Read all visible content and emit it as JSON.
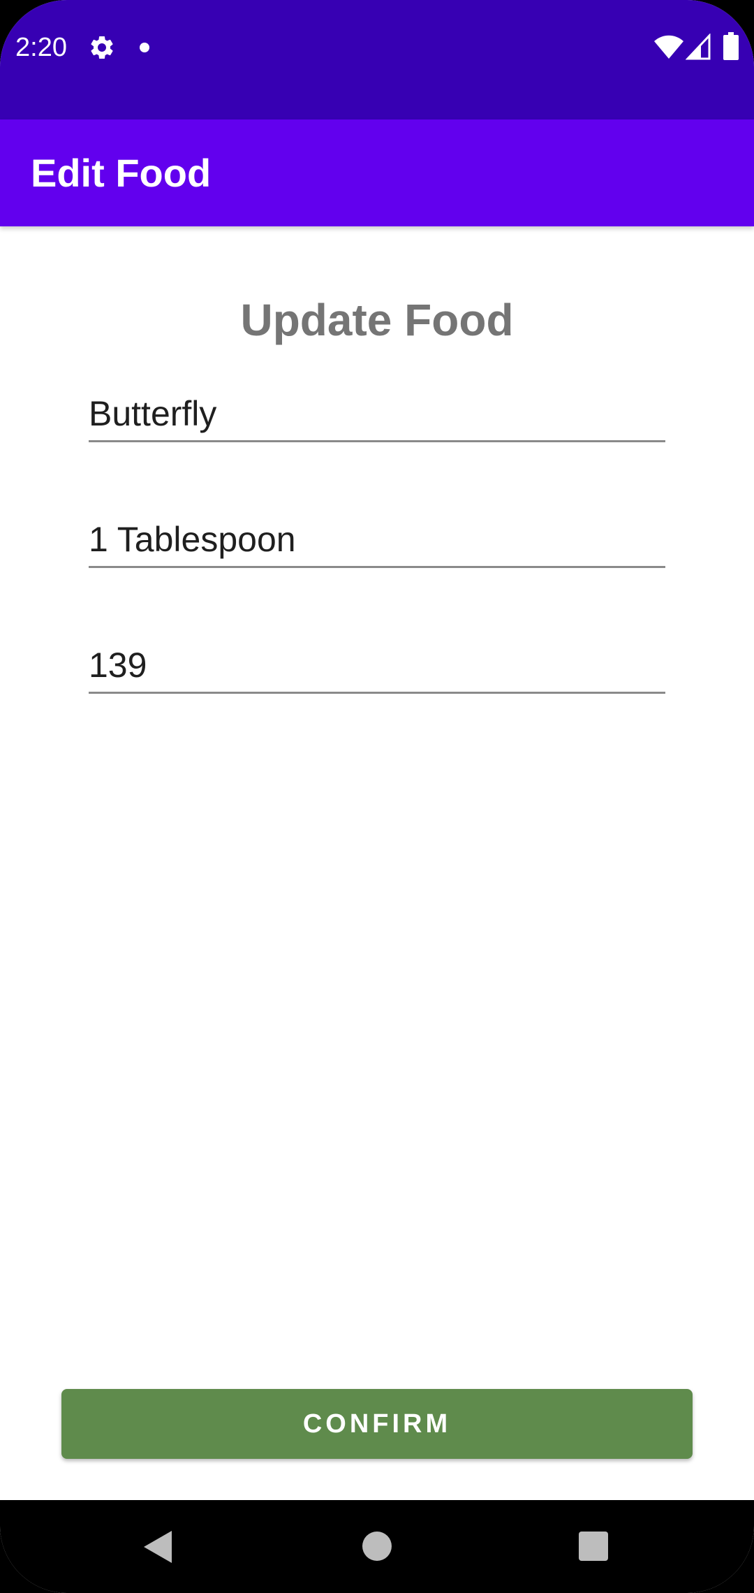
{
  "status_bar": {
    "time": "2:20",
    "icons": [
      "gear-icon",
      "notification-dot-icon",
      "wifi-icon",
      "cell-signal-icon",
      "battery-icon"
    ],
    "background_color": "#3700b3"
  },
  "app_bar": {
    "title": "Edit Food",
    "background_color": "#6200ee"
  },
  "form": {
    "heading": "Update Food",
    "fields": [
      {
        "value": "Butterfly"
      },
      {
        "value": "1 Tablespoon"
      },
      {
        "value": "139"
      }
    ]
  },
  "confirm_button": {
    "label": "CONFIRM",
    "color": "#5f8b4c"
  },
  "nav_bar": {
    "icons": [
      "back-icon",
      "home-icon",
      "recents-icon"
    ]
  }
}
